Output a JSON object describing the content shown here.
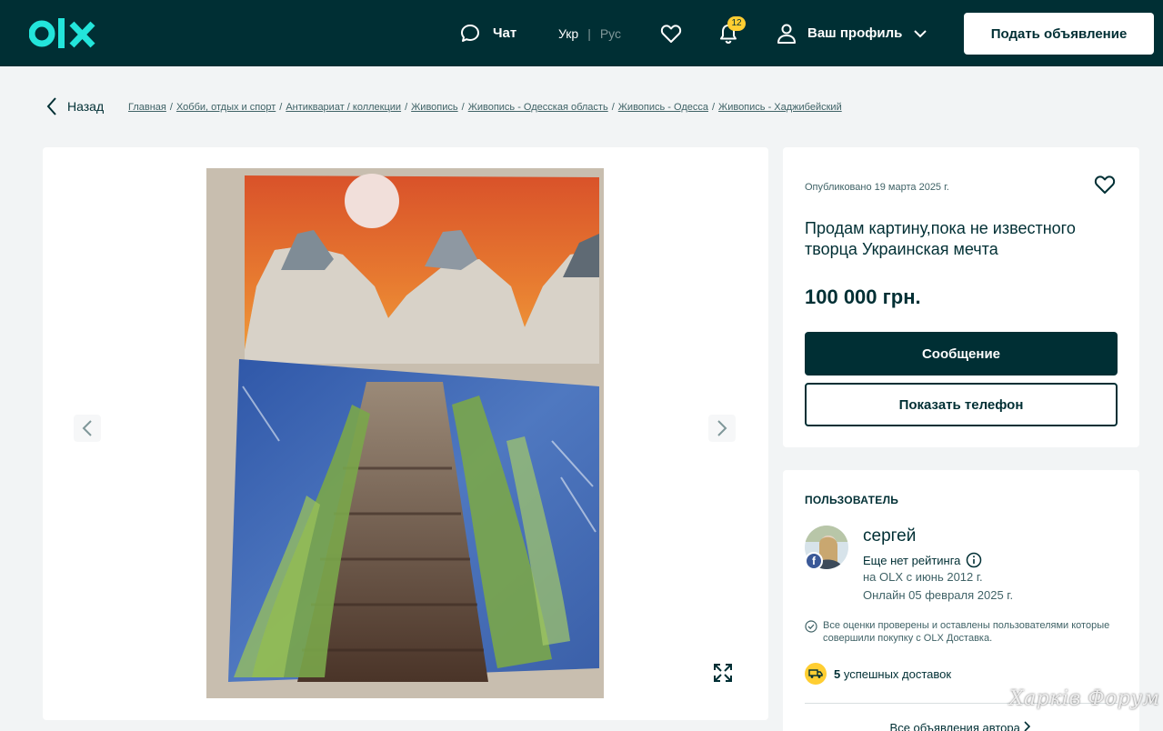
{
  "header": {
    "logo_text": "olx",
    "chat_label": "Чат",
    "lang_active": "Укр",
    "lang_separator": "|",
    "lang_inactive": "Рус",
    "notifications_count": "12",
    "profile_label": "Ваш профиль",
    "post_ad_label": "Подать объявление"
  },
  "breadcrumb": {
    "back_label": "Назад",
    "items": [
      "Главная",
      "Хобби, отдых и спорт",
      "Антиквариат / коллекции",
      "Живопись",
      "Живопись - Одесская область",
      "Живопись - Одесса",
      "Живопись - Хаджибейский"
    ],
    "separator": "/"
  },
  "ad": {
    "published": "Опубликовано 19 марта 2025 г.",
    "title": "Продам картину,пока не известного творца Украинская мечта",
    "price": "100 000 грн.",
    "message_button": "Сообщение",
    "phone_button": "Показать телефон"
  },
  "user": {
    "section_title": "ПОЛЬЗОВАТЕЛЬ",
    "name": "сергей",
    "rating": "Еще нет рейтинга",
    "since": "на OLX с июнь 2012 г.",
    "online": "Онлайн 05 февраля 2025 г.",
    "verified_note": "Все оценки проверены и оставлены пользователями которые совершили покупку с OLX Доставка.",
    "deliveries_count": "5",
    "deliveries_label": "успешных доставок",
    "all_ads_link": "Все объявления автора"
  },
  "watermark": "Харків Форум",
  "icons": {
    "chat": "chat-bubble-icon",
    "favorite": "heart-icon",
    "notifications": "bell-icon",
    "profile": "user-icon",
    "dropdown": "chevron-down-icon",
    "back": "chevron-left-icon",
    "prev": "chevron-left-icon",
    "next": "chevron-right-icon",
    "fullscreen": "expand-icon",
    "info": "info-icon",
    "verified": "check-circle-icon",
    "delivery": "truck-icon"
  },
  "colors": {
    "brand_dark": "#002f34",
    "brand_teal": "#23e5db",
    "badge_yellow": "#ffce32",
    "background": "#f2f4f5"
  }
}
